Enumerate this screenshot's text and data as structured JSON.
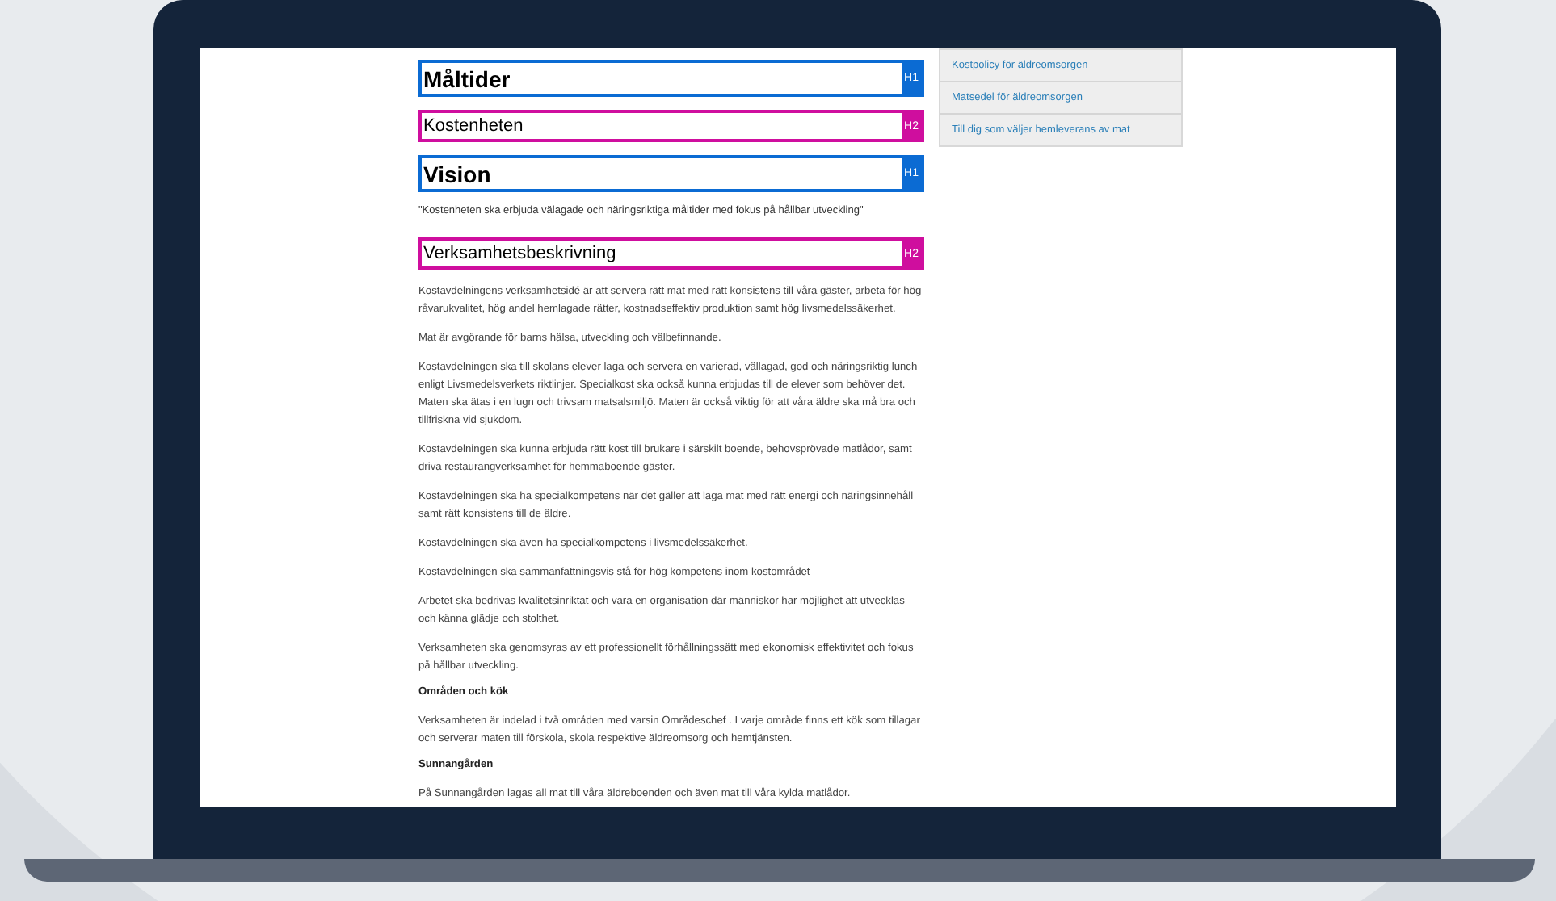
{
  "blocks": [
    {
      "kind": "h1",
      "text": "Måltider",
      "tag": "H1"
    },
    {
      "kind": "h2",
      "text": "Kostenheten",
      "tag": "H2"
    },
    {
      "kind": "h1",
      "text": "Vision",
      "tag": "H1"
    },
    {
      "kind": "quote",
      "text": "\"Kostenheten ska erbjuda välagade och näringsriktiga måltider med fokus på hållbar utveckling\""
    },
    {
      "kind": "h2",
      "text": "Verksamhetsbeskrivning",
      "tag": "H2"
    },
    {
      "kind": "p",
      "text": "Kostavdelningens verksamhetsidé är att servera rätt mat med rätt konsistens till våra gäster, arbeta för hög råvarukvalitet, hög andel hemlagade rätter, kostnadseffektiv produktion samt hög livsmedelssäkerhet."
    },
    {
      "kind": "p",
      "text": "Mat är avgörande för barns hälsa, utveckling och välbefinnande."
    },
    {
      "kind": "p",
      "text": "Kostavdelningen ska till skolans elever laga och servera en varierad, vällagad, god och näringsriktig lunch enligt Livsmedelsverkets riktlinjer. Specialkost ska också kunna erbjudas till de elever som behöver det. Maten ska ätas i en lugn och trivsam matsalsmiljö. Maten är också viktig för att våra äldre ska må bra och tillfriskna vid sjukdom."
    },
    {
      "kind": "p",
      "text": "Kostavdelningen ska kunna erbjuda rätt kost till brukare i särskilt boende, behovsprövade matlådor, samt driva restaurangverksamhet för hemmaboende gäster."
    },
    {
      "kind": "p",
      "text": "Kostavdelningen ska ha specialkompetens när det gäller att laga mat med rätt energi och näringsinnehåll samt rätt konsistens till de äldre."
    },
    {
      "kind": "p",
      "text": "Kostavdelningen ska även ha specialkompetens i livsmedelssäkerhet."
    },
    {
      "kind": "p",
      "text": "Kostavdelningen ska sammanfattningsvis stå för hög kompetens inom kostområdet"
    },
    {
      "kind": "p",
      "text": "Arbetet ska bedrivas kvalitetsinriktat och vara en organisation där människor har möjlighet att utvecklas och känna glädje och stolthet."
    },
    {
      "kind": "p",
      "text": "Verksamheten ska genomsyras av ett professionellt förhållningssätt med ekonomisk effektivitet och fokus på hållbar utveckling."
    },
    {
      "kind": "sub",
      "text": "Områden och kök"
    },
    {
      "kind": "p",
      "text": "Verksamheten är indelad i två områden med varsin Områdeschef . I varje område finns ett kök som tillagar och serverar maten till förskola, skola respektive äldreomsorg och hemtjänsten."
    },
    {
      "kind": "sub",
      "text": "Sunnangården"
    },
    {
      "kind": "p",
      "text": "På Sunnangården lagas all mat till våra äldreboenden och även mat till våra kylda matlådor."
    }
  ],
  "sidebar": {
    "links": [
      "Kostpolicy för äldreomsorgen",
      "Matsedel för äldreomsorgen",
      "Till dig som väljer hemleverans av mat"
    ]
  }
}
